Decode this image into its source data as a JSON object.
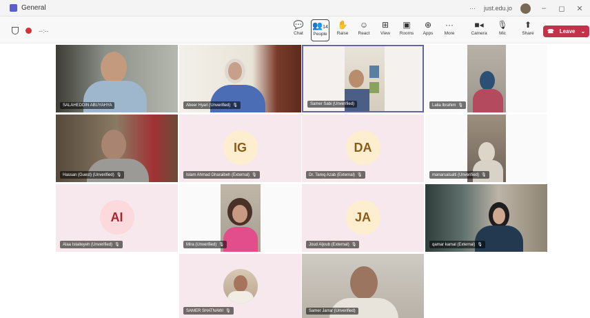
{
  "window": {
    "title": "General",
    "account": "just.edu.jo",
    "more": "···"
  },
  "toolbar": {
    "timer": "--:--",
    "buttons": [
      {
        "label": "Chat",
        "icon": "chat-icon"
      },
      {
        "label": "People",
        "icon": "people-icon",
        "count": "14"
      },
      {
        "label": "Raise",
        "icon": "hand-icon"
      },
      {
        "label": "React",
        "icon": "smile-icon"
      },
      {
        "label": "View",
        "icon": "grid-icon"
      },
      {
        "label": "Rooms",
        "icon": "rooms-icon"
      },
      {
        "label": "Apps",
        "icon": "apps-icon"
      },
      {
        "label": "More",
        "icon": "more-icon"
      },
      {
        "label": "Camera",
        "icon": "camera-icon"
      },
      {
        "label": "Mic",
        "icon": "mic-icon"
      },
      {
        "label": "Share",
        "icon": "share-icon"
      }
    ],
    "leave": "Leave"
  },
  "participants": [
    {
      "name": "SALAHEDDIN ABUYAHYA"
    },
    {
      "name": "Abeer Hyari (Unverified)"
    },
    {
      "name": "Samer Sabi (Unverified)"
    },
    {
      "name": "Laila Ibrahim"
    },
    {
      "name": "Hassan (Guest) (Unverified)"
    },
    {
      "name": "Islam Ahmad Gharaibeh (External)",
      "initials": "IG"
    },
    {
      "name": "Dr. Tareq Azab (External)",
      "initials": "DA"
    },
    {
      "name": "manarsalsalti (Unverified)"
    },
    {
      "name": "Alaa Istaiteyeh (Unverified)",
      "initials": "AI"
    },
    {
      "name": "Mira (Unverified)"
    },
    {
      "name": "Joud Aljoub (External)",
      "initials": "JA"
    },
    {
      "name": "qamar kamal (External)"
    },
    {
      "name": "SAMER SHATNAWI"
    },
    {
      "name": "Samer Jarrar (Unverified)"
    }
  ],
  "colors": {
    "accent": "#6264a7",
    "leave": "#c4314b",
    "avatar_bg": "#fdeed0",
    "avatar_text": "#8a5a1a"
  }
}
